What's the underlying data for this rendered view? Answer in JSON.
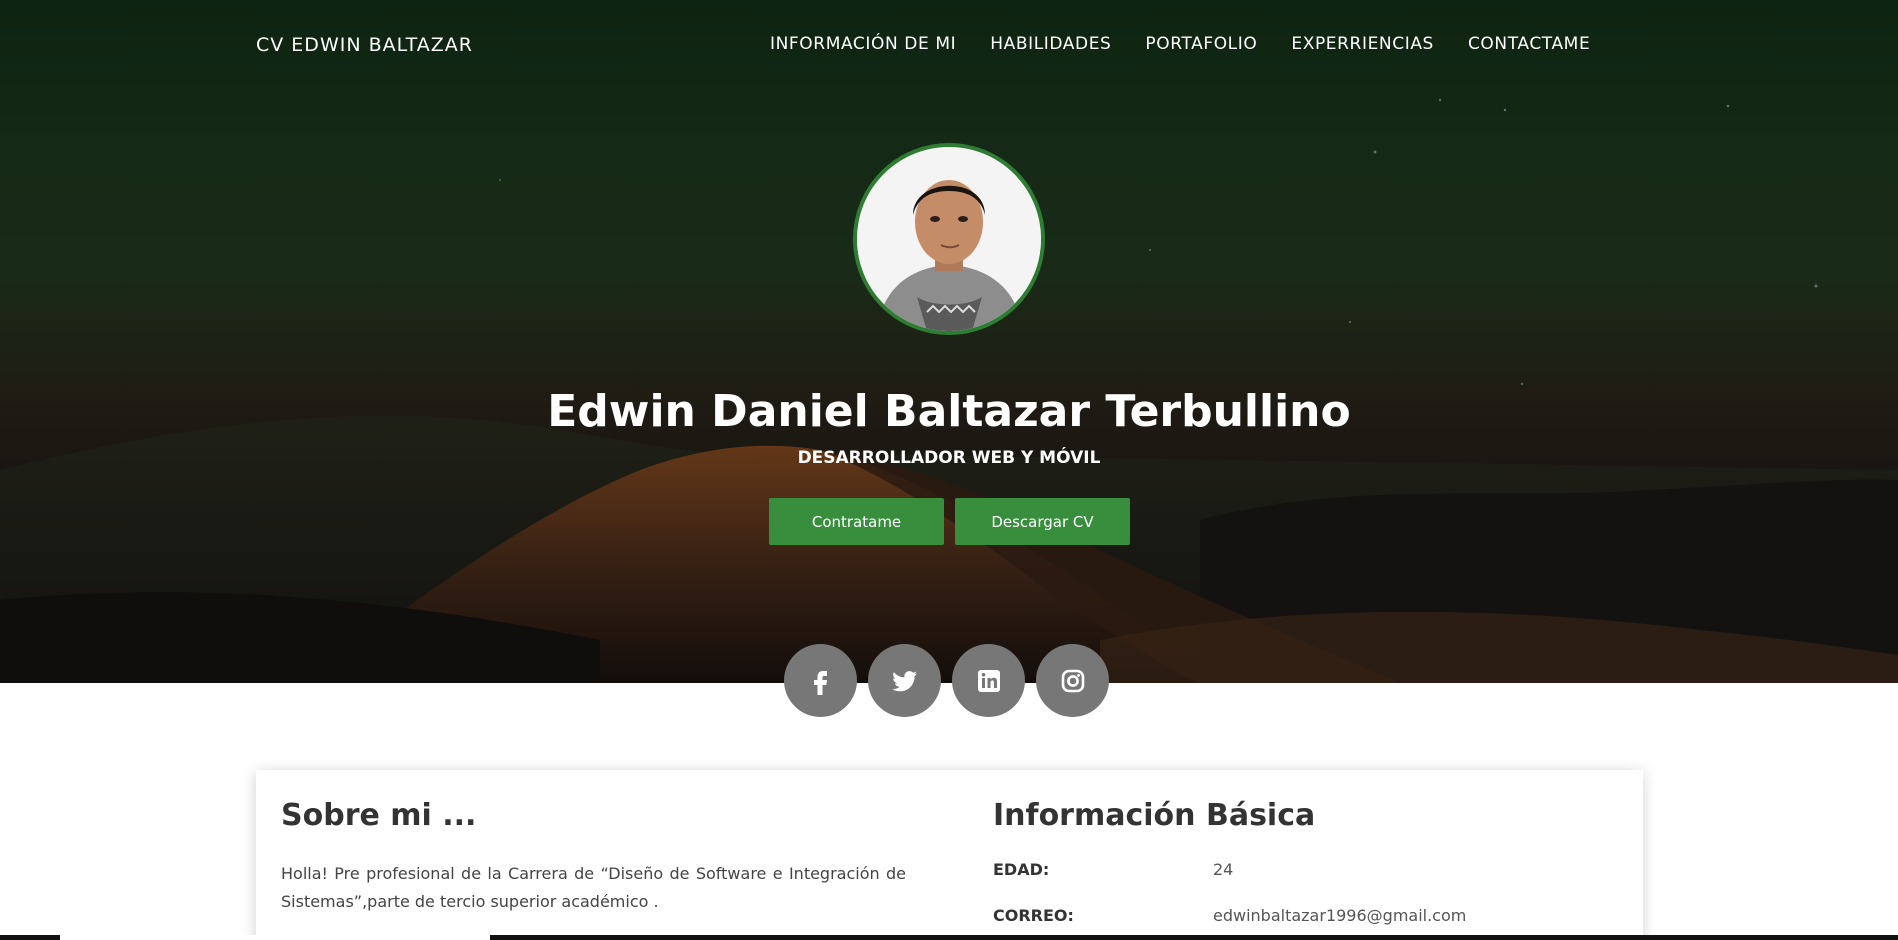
{
  "nav": {
    "brand": "CV EDWIN BALTAZAR",
    "links": [
      "INFORMACIÓN DE MI",
      "HABILIDADES",
      "PORTAFOLIO",
      "EXPERRIENCIAS",
      "CONTACTAME"
    ]
  },
  "hero": {
    "name": "Edwin Daniel Baltazar Terbullino",
    "role": "DESARROLLADOR WEB Y MÓVIL",
    "buttons": {
      "hire": "Contratame",
      "download": "Descargar CV"
    }
  },
  "socials": [
    "facebook-icon",
    "twitter-icon",
    "linkedin-icon",
    "instagram-icon"
  ],
  "about": {
    "title": "Sobre mi ...",
    "text": "Holla! Pre profesional de la Carrera de “Diseño de Software e Integración de Sistemas”,parte de tercio superior académico ."
  },
  "info": {
    "title": "Información Básica",
    "age_label": "EDAD:",
    "age_value": "24",
    "email_label": "CORREO:",
    "email_value": "edwinbaltazar1996@gmail.com"
  },
  "colors": {
    "accent": "#388e3c",
    "avatar_border": "#2e7d32",
    "social_bg": "#777777"
  }
}
